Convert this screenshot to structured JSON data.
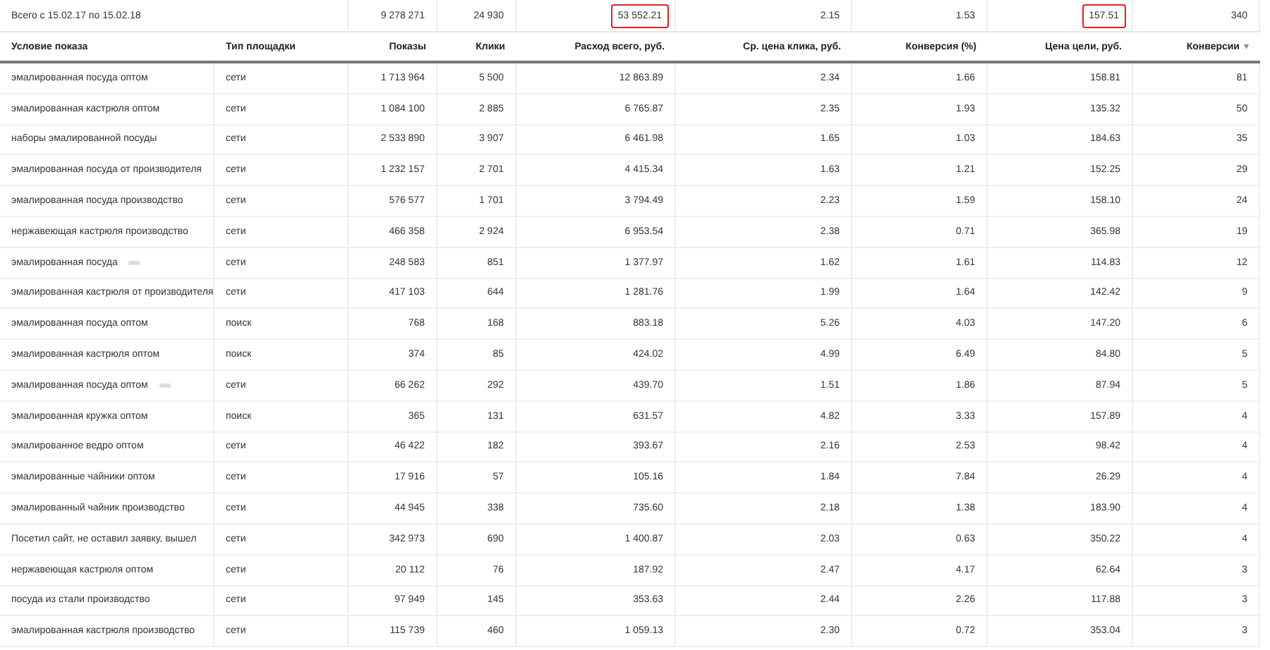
{
  "total": {
    "label": "Всего с 15.02.17 по 15.02.18",
    "values": [
      {
        "text": "9 278 271",
        "highlighted": false
      },
      {
        "text": "24 930",
        "highlighted": false
      },
      {
        "text": "53 552.21",
        "highlighted": true
      },
      {
        "text": "2.15",
        "highlighted": false
      },
      {
        "text": "1.53",
        "highlighted": false
      },
      {
        "text": "157.51",
        "highlighted": true
      },
      {
        "text": "340",
        "highlighted": false
      }
    ]
  },
  "columns": [
    {
      "label": "Условие показа"
    },
    {
      "label": "Тип площадки"
    },
    {
      "label": "Показы"
    },
    {
      "label": "Клики"
    },
    {
      "label": "Расход всего, руб."
    },
    {
      "label": "Ср. цена клика, руб."
    },
    {
      "label": "Конверсия (%)"
    },
    {
      "label": "Цена цели, руб."
    },
    {
      "label": "Конверсии",
      "sort_mark": "▾"
    }
  ],
  "rows": [
    {
      "condition": "эмалированная посуда оптом",
      "tag": false,
      "type": "сети",
      "values": [
        "1 713 964",
        "5 500",
        "12 863.89",
        "2.34",
        "1.66",
        "158.81",
        "81"
      ]
    },
    {
      "condition": "эмалированная кастрюля оптом",
      "tag": false,
      "type": "сети",
      "values": [
        "1 084 100",
        "2 885",
        "6 765.87",
        "2.35",
        "1.93",
        "135.32",
        "50"
      ]
    },
    {
      "condition": "наборы эмалированной посуды",
      "tag": false,
      "type": "сети",
      "values": [
        "2 533 890",
        "3 907",
        "6 461.98",
        "1.65",
        "1.03",
        "184.63",
        "35"
      ]
    },
    {
      "condition": "эмалированная посуда от производителя",
      "tag": false,
      "type": "сети",
      "values": [
        "1 232 157",
        "2 701",
        "4 415.34",
        "1.63",
        "1.21",
        "152.25",
        "29"
      ]
    },
    {
      "condition": "эмалированная посуда производство",
      "tag": false,
      "type": "сети",
      "values": [
        "576 577",
        "1 701",
        "3 794.49",
        "2.23",
        "1.59",
        "158.10",
        "24"
      ]
    },
    {
      "condition": "нержавеющая кастрюля производство",
      "tag": false,
      "type": "сети",
      "values": [
        "466 358",
        "2 924",
        "6 953.54",
        "2.38",
        "0.71",
        "365.98",
        "19"
      ]
    },
    {
      "condition": "эмалированная посуда",
      "tag": true,
      "type": "сети",
      "values": [
        "248 583",
        "851",
        "1 377.97",
        "1.62",
        "1.61",
        "114.83",
        "12"
      ]
    },
    {
      "condition": "эмалированная кастрюля от производителя",
      "tag": false,
      "type": "сети",
      "values": [
        "417 103",
        "644",
        "1 281.76",
        "1.99",
        "1.64",
        "142.42",
        "9"
      ]
    },
    {
      "condition": "эмалированная посуда оптом",
      "tag": false,
      "type": "поиск",
      "values": [
        "768",
        "168",
        "883.18",
        "5.26",
        "4.03",
        "147.20",
        "6"
      ]
    },
    {
      "condition": "эмалированная кастрюля оптом",
      "tag": false,
      "type": "поиск",
      "values": [
        "374",
        "85",
        "424.02",
        "4.99",
        "6.49",
        "84.80",
        "5"
      ]
    },
    {
      "condition": "эмалированная посуда оптом",
      "tag": true,
      "type": "сети",
      "values": [
        "66 262",
        "292",
        "439.70",
        "1.51",
        "1.86",
        "87.94",
        "5"
      ]
    },
    {
      "condition": "эмалированная кружка оптом",
      "tag": false,
      "type": "поиск",
      "values": [
        "365",
        "131",
        "631.57",
        "4.82",
        "3.33",
        "157.89",
        "4"
      ]
    },
    {
      "condition": "эмалированное ведро оптом",
      "tag": false,
      "type": "сети",
      "values": [
        "46 422",
        "182",
        "393.67",
        "2.16",
        "2.53",
        "98.42",
        "4"
      ]
    },
    {
      "condition": "эмалированные чайники оптом",
      "tag": false,
      "type": "сети",
      "values": [
        "17 916",
        "57",
        "105.16",
        "1.84",
        "7.84",
        "26.29",
        "4"
      ]
    },
    {
      "condition": "эмалированный чайник производство",
      "tag": false,
      "type": "сети",
      "values": [
        "44 945",
        "338",
        "735.60",
        "2.18",
        "1.38",
        "183.90",
        "4"
      ]
    },
    {
      "condition": "Посетил сайт, не оставил заявку, вышел",
      "tag": false,
      "type": "сети",
      "values": [
        "342 973",
        "690",
        "1 400.87",
        "2.03",
        "0.63",
        "350.22",
        "4"
      ]
    },
    {
      "condition": "нержавеющая кастрюля оптом",
      "tag": false,
      "type": "сети",
      "values": [
        "20 112",
        "76",
        "187.92",
        "2.47",
        "4.17",
        "62.64",
        "3"
      ]
    },
    {
      "condition": "посуда из стали производство",
      "tag": false,
      "type": "сети",
      "values": [
        "97 949",
        "145",
        "353.63",
        "2.44",
        "2.26",
        "117.88",
        "3"
      ]
    },
    {
      "condition": "эмалированная кастрюля производство",
      "tag": false,
      "type": "сети",
      "values": [
        "115 739",
        "460",
        "1 059.13",
        "2.30",
        "0.72",
        "353.04",
        "3"
      ]
    }
  ]
}
